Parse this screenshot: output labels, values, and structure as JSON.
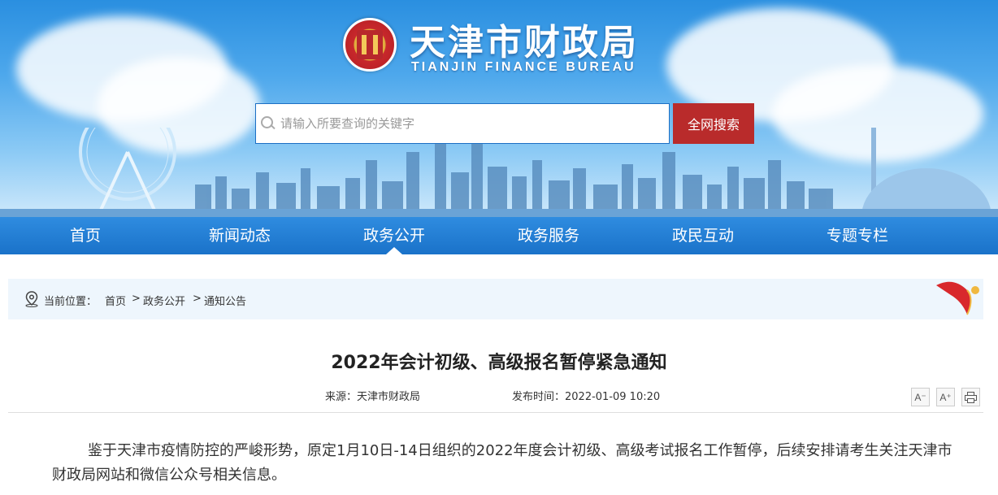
{
  "header": {
    "title": "天津市财政局",
    "subtitle": "TIANJIN FINANCE BUREAU",
    "logo_icon": "emblem-icon"
  },
  "search": {
    "placeholder": "请输入所要查询的关键字",
    "button_label": "全网搜索"
  },
  "nav": {
    "items": [
      {
        "label": "首页"
      },
      {
        "label": "新闻动态"
      },
      {
        "label": "政务公开"
      },
      {
        "label": "政务服务"
      },
      {
        "label": "政民互动"
      },
      {
        "label": "专题专栏"
      }
    ],
    "active": "政务公开"
  },
  "breadcrumb": {
    "prefix": "当前位置：",
    "items": [
      "首页",
      "政务公开",
      "通知公告"
    ],
    "separator": ">"
  },
  "article": {
    "title": "2022年会计初级、高级报名暂停紧急通知",
    "source": "来源：天津市财政局",
    "publish_time": "发布时间：2022-01-09 10:20",
    "font_decrease": "A⁻",
    "font_increase": "A⁺",
    "body": "鉴于天津市疫情防控的严峻形势，原定1月10日-14日组织的2022年度会计初级、高级考试报名工作暂停，后续安排请考生关注天津市财政局网站和微信公众号相关信息。"
  },
  "colors": {
    "nav_blue": "#1a72c9",
    "search_red": "#b92b2b",
    "crumb_bg": "#eef6fd"
  }
}
